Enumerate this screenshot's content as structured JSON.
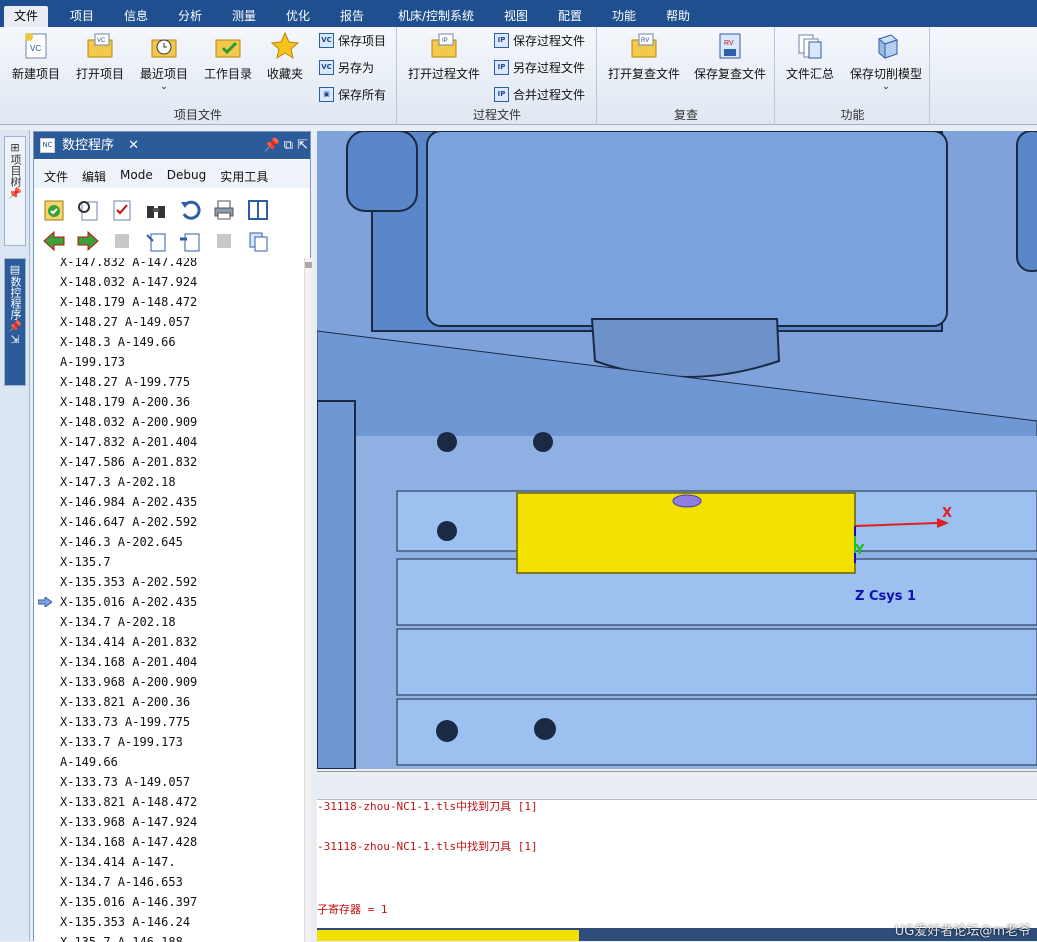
{
  "menu": [
    "文件",
    "项目",
    "信息",
    "分析",
    "测量",
    "优化",
    "报告",
    "机床/控制系统",
    "视图",
    "配置",
    "功能",
    "帮助"
  ],
  "ribbon": {
    "file_group": {
      "label": "项目文件",
      "new_project": "新建项目",
      "open_project": "打开项目",
      "recent_projects": "最近项目",
      "work_dir": "工作目录",
      "favorites": "收藏夹",
      "save_project": "保存项目",
      "save_as": "另存为",
      "save_all": "保存所有"
    },
    "process_group": {
      "label": "过程文件",
      "open_process": "打开过程文件",
      "save_process": "保存过程文件",
      "save_process_as": "另存过程文件",
      "merge_process": "合并过程文件"
    },
    "review_group": {
      "label": "复查",
      "open_review": "打开复查文件",
      "save_review": "保存复查文件"
    },
    "func_group": {
      "label": "功能",
      "file_summary": "文件汇总",
      "save_cut_model": "保存切削模型"
    }
  },
  "leftbar": {
    "project_tree": "项目树",
    "nc_program": "数控程序"
  },
  "panel": {
    "title": "数控程序",
    "menu": [
      "文件",
      "编辑",
      "Mode",
      "Debug",
      "实用工具"
    ]
  },
  "code_lines": [
    "X-147.832 A-147.428",
    "X-148.032 A-147.924",
    "X-148.179 A-148.472",
    "X-148.27 A-149.057",
    "X-148.3 A-149.66",
    "A-199.173",
    "X-148.27 A-199.775",
    "X-148.179 A-200.36",
    "X-148.032 A-200.909",
    "X-147.832 A-201.404",
    "X-147.586 A-201.832",
    "X-147.3 A-202.18",
    "X-146.984 A-202.435",
    "X-146.647 A-202.592",
    "X-146.3 A-202.645",
    "X-135.7",
    "X-135.353 A-202.592",
    "X-135.016 A-202.435",
    "X-134.7 A-202.18",
    "X-134.414 A-201.832",
    "X-134.168 A-201.404",
    "X-133.968 A-200.909",
    "X-133.821 A-200.36",
    "X-133.73 A-199.775",
    "X-133.7 A-199.173",
    "A-149.66",
    "X-133.73 A-149.057",
    "X-133.821 A-148.472",
    "X-133.968 A-147.924",
    "X-134.168 A-147.428",
    "X-134.414 A-147.",
    "X-134.7 A-146.653",
    "X-135.016 A-146.397",
    "X-135.353 A-146.24",
    "X-135.7 A-146.188"
  ],
  "current_line_index": 17,
  "viewport": {
    "axis_x": "X",
    "axis_y": "Y",
    "csys": "Z Csys 1"
  },
  "console": [
    "-31118-zhou-NC1-1.tls中找到刀具 [1]",
    "-31118-zhou-NC1-1.tls中找到刀具 [1]",
    "子寄存器 = 1"
  ],
  "watermark": "UG爱好者论坛@m老爷",
  "colors": {
    "accent": "#2b5b99",
    "part": "#f2e000",
    "table": "#8fb0e3"
  }
}
